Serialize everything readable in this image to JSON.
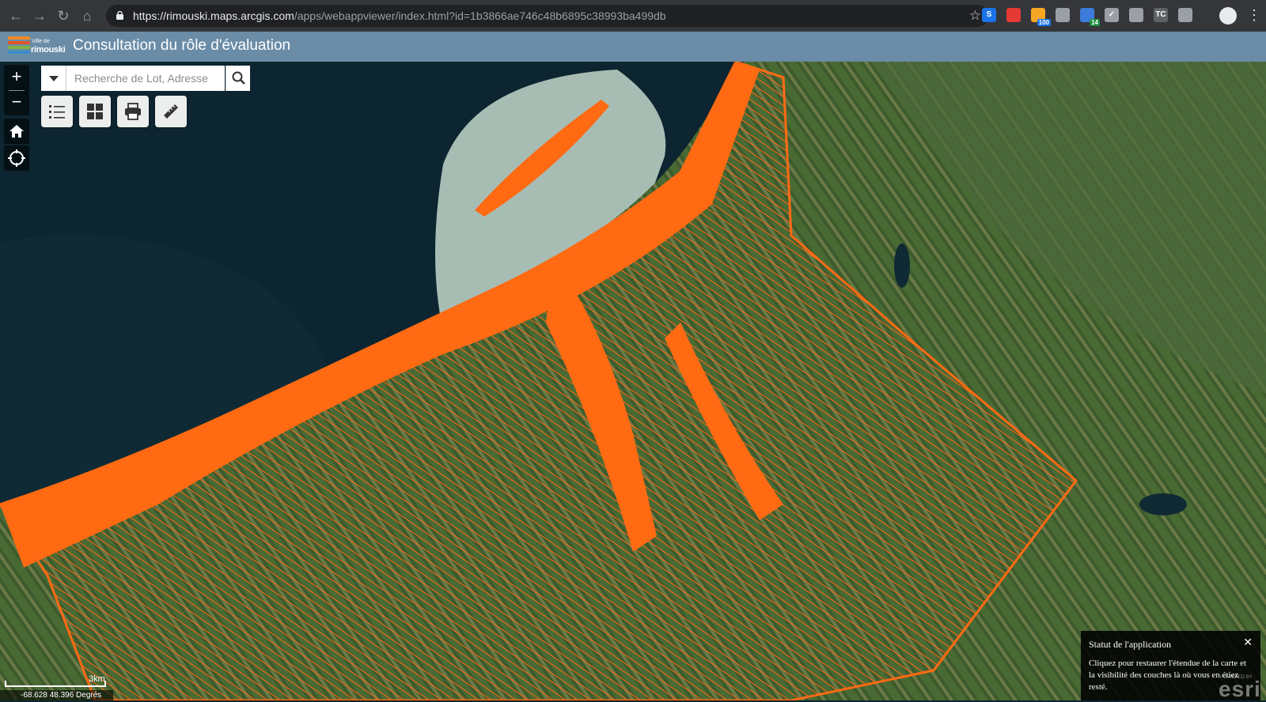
{
  "browser": {
    "url_host": "https://rimouski.maps.arcgis.com",
    "url_path": "/apps/webappviewer/index.html?id=1b3866ae746c48b6895c38993ba499db",
    "extensions": [
      {
        "icon": "s-extension-icon",
        "label": "S",
        "color": "#1a73e8"
      },
      {
        "icon": "shield-extension-icon",
        "label": "",
        "color": "#e53935"
      },
      {
        "icon": "rss-extension-icon",
        "label": "",
        "color": "#f5a623",
        "badge": "100",
        "badge_color": "#1a73e8"
      },
      {
        "icon": "copy-extension-icon",
        "label": "",
        "color": "#9aa0a6"
      },
      {
        "icon": "drop-extension-icon",
        "label": "",
        "color": "#3c7bd9",
        "badge": "14",
        "badge_color": "#1e8e3e"
      },
      {
        "icon": "check-extension-icon",
        "label": "✓",
        "color": "#9aa0a6"
      },
      {
        "icon": "globe-extension-icon",
        "label": "",
        "color": "#9aa0a6"
      },
      {
        "icon": "tc-extension-icon",
        "label": "TC",
        "color": "#5f6368"
      },
      {
        "icon": "puzzle-extension-icon",
        "label": "",
        "color": "#9aa0a6"
      }
    ]
  },
  "app": {
    "logo_small": "Ville de",
    "logo_name": "rimouski",
    "title": "Consultation du rôle d'évaluation"
  },
  "search": {
    "placeholder": "Recherche de Lot, Adresse"
  },
  "map": {
    "scale_label": "3km",
    "coordinates": "-68.628 48.396 Degrés",
    "parcel_color": "#ff6a13",
    "water_color": "#0d2530"
  },
  "status": {
    "title": "Statut de l'application",
    "message": "Cliquez pour restaurer l'étendue de la carte et la visibilité des couches là où vous en étiez resté."
  },
  "attribution": {
    "small": "POWERED BY",
    "brand": "esri"
  }
}
